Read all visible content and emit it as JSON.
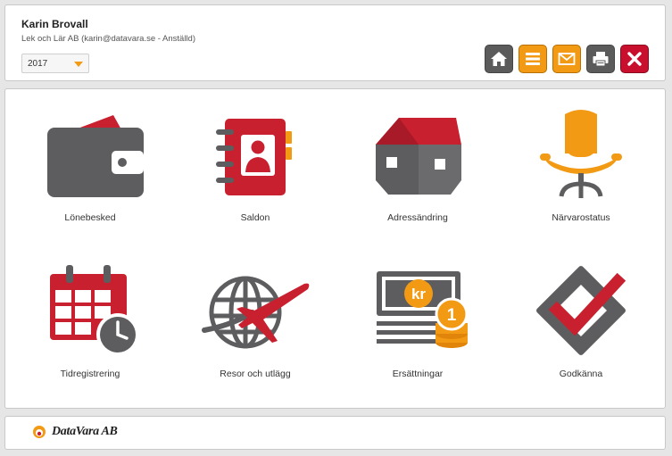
{
  "header": {
    "user_name": "Karin Brovall",
    "user_info": "Lek och Lär AB (karin@datavara.se - Anställd)",
    "year_select": {
      "value": "2017"
    },
    "toolbar": [
      {
        "name": "home-button",
        "icon": "home-icon",
        "bg": "#5b5b5b",
        "border": "#444444"
      },
      {
        "name": "menu-button",
        "icon": "menu-icon",
        "bg": "#f29a14",
        "border": "#b86f00"
      },
      {
        "name": "mail-button",
        "icon": "mail-icon",
        "bg": "#f29a14",
        "border": "#b86f00"
      },
      {
        "name": "print-button",
        "icon": "printer-icon",
        "bg": "#5b5b5b",
        "border": "#444444"
      },
      {
        "name": "close-button",
        "icon": "close-icon",
        "bg": "#c8102e",
        "border": "#8d0a1f"
      }
    ]
  },
  "tiles": [
    {
      "name": "tile-lonebesked",
      "label": "Lönebesked",
      "icon": "wallet-icon"
    },
    {
      "name": "tile-saldon",
      "label": "Saldon",
      "icon": "address-book-icon"
    },
    {
      "name": "tile-adressandring",
      "label": "Adressändring",
      "icon": "house-icon"
    },
    {
      "name": "tile-narvarostatus",
      "label": "Närvarostatus",
      "icon": "office-chair-icon"
    },
    {
      "name": "tile-tidregistrering",
      "label": "Tidregistrering",
      "icon": "calendar-clock-icon"
    },
    {
      "name": "tile-resor-och-utlagg",
      "label": "Resor och utlägg",
      "icon": "globe-airplane-icon"
    },
    {
      "name": "tile-ersattningar",
      "label": "Ersättningar",
      "icon": "money-coins-icon"
    },
    {
      "name": "tile-godkanna",
      "label": "Godkänna",
      "icon": "checkmark-icon"
    }
  ],
  "tile_currency_text": "kr",
  "tile_coin_text": "1",
  "footer": {
    "logo_text": "DataVara AB"
  },
  "colors": {
    "gray": "#5d5d5f",
    "red": "#c8202f",
    "orange": "#f29a14",
    "background": "#e6e6e6"
  }
}
